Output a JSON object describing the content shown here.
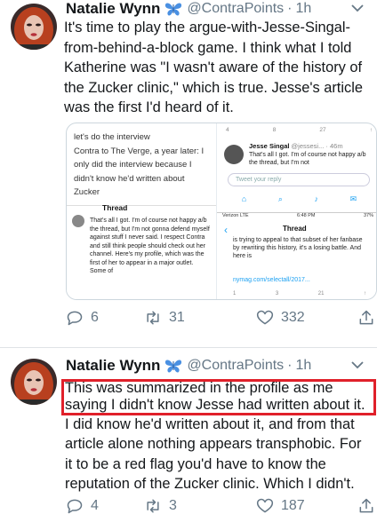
{
  "tweets": [
    {
      "name": "Natalie Wynn",
      "handle": "@ContraPoints",
      "separator": "·",
      "time": "1h",
      "text_lines": [
        "It's time to play the argue-with-Jesse-Singal-",
        "from-behind-a-block game. I think what I told",
        "Katherine was \"I wasn't aware of the history of",
        "the Zucker clinic,\" which is true. Jesse's article",
        "was the first I'd heard of it."
      ],
      "embedded_image": {
        "notes_lines": [
          "let's do the interview",
          "Contra to The Verge, a year later: I",
          "only did the interview because I",
          "didn't know he'd written about",
          "Zucker"
        ],
        "left_thread_title": "Thread",
        "left_thread_text": "That's all I got. I'm of course not happy a/b the thread, but I'm not gonna defend myself against stuff I never said. I respect Contra and still think people should check out her channel. Here's my profile, which was the first of her to appear in a major outlet. Some of",
        "right_top_counts": [
          "4",
          "8",
          "27"
        ],
        "right_top_name": "Jesse Singal",
        "right_top_handle": "@jessesi... · 46m",
        "right_top_text": "That's all I got. I'm of course not happy a/b the thread, but I'm not",
        "reply_placeholder": "Tweet your reply",
        "right_bottom_status_left": "Verizon LTE",
        "right_bottom_status_mid": "6:48 PM",
        "right_bottom_status_right": "37%",
        "right_bottom_title": "Thread",
        "right_bottom_text": "is trying to appeal to that subset of her fanbase by rewriting this history, it's a losing battle. And here is",
        "right_bottom_link": "nymag.com/selectall/2017...",
        "right_bottom_counts": [
          "1",
          "3",
          "21"
        ]
      },
      "actions": {
        "replies": "6",
        "retweets": "31",
        "likes": "332"
      }
    },
    {
      "name": "Natalie Wynn",
      "handle": "@ContraPoints",
      "separator": "·",
      "time": "1h",
      "highlight_lines": [
        "This was summarized in the profile as me",
        "saying I didn't know Jesse had written about it."
      ],
      "text_lines": [
        "I did know he'd written about it, and from that",
        "article alone nothing appears transphobic. For",
        "it to be a red flag you'd have to know the",
        "reputation of the Zucker clinic. Which I didn't."
      ],
      "actions": {
        "replies": "4",
        "retweets": "3",
        "likes": "187"
      }
    }
  ],
  "icons": [
    "butterfly-icon",
    "chevron-down-icon",
    "reply-icon",
    "retweet-icon",
    "like-icon",
    "share-icon"
  ],
  "colors": {
    "text": "#14171a",
    "secondary": "#657786",
    "butterfly": "#4a90e2",
    "highlight_border": "#e0202a",
    "link": "#1da1f2"
  }
}
